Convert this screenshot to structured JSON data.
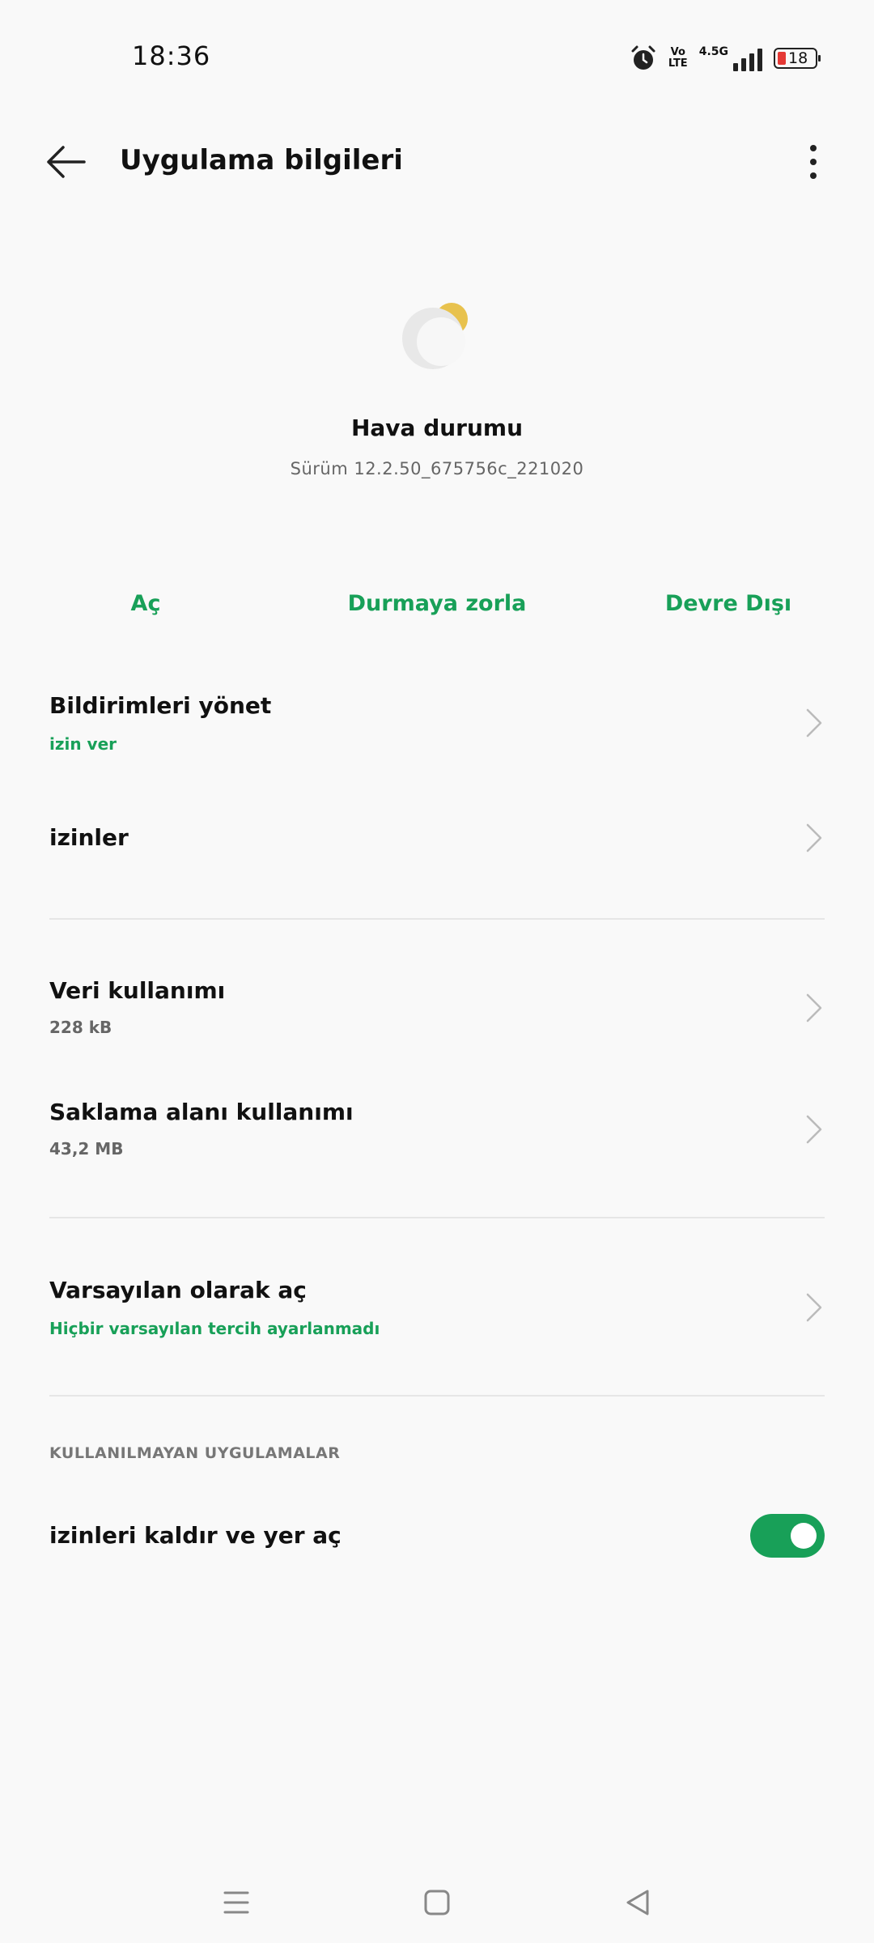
{
  "status_bar": {
    "time": "18:36",
    "volte_top": "Vo",
    "volte_bottom": "LTE",
    "network": "4.5G",
    "battery": "18",
    "battery_color": "#e53935"
  },
  "header": {
    "title": "Uygulama bilgileri",
    "back_icon": "arrow-left-icon",
    "menu_icon": "more-vertical-icon"
  },
  "app": {
    "name": "Hava durumu",
    "version": "Sürüm 12.2.50_675756c_221020"
  },
  "actions": {
    "open": "Aç",
    "force_stop": "Durmaya zorla",
    "disable": "Devre Dışı",
    "accent_color": "#18a058"
  },
  "list": {
    "notifications": {
      "title": "Bildirimleri yönet",
      "subtitle": "izin ver"
    },
    "permissions": {
      "title": "izinler"
    },
    "data_usage": {
      "title": "Veri kullanımı",
      "subtitle": "228 kB"
    },
    "storage": {
      "title": "Saklama alanı kullanımı",
      "subtitle": "43,2 MB"
    },
    "open_default": {
      "title": "Varsayılan olarak aç",
      "subtitle": "Hiçbir varsayılan tercih ayarlanmadı"
    }
  },
  "unused_apps": {
    "section_label": "KULLANILMAYAN UYGULAMALAR",
    "toggle_label": "izinleri kaldır ve yer aç",
    "toggle_on": true
  },
  "nav": {
    "menu_icon": "menu-icon",
    "home_icon": "home-square-icon",
    "back_icon": "back-triangle-icon"
  }
}
